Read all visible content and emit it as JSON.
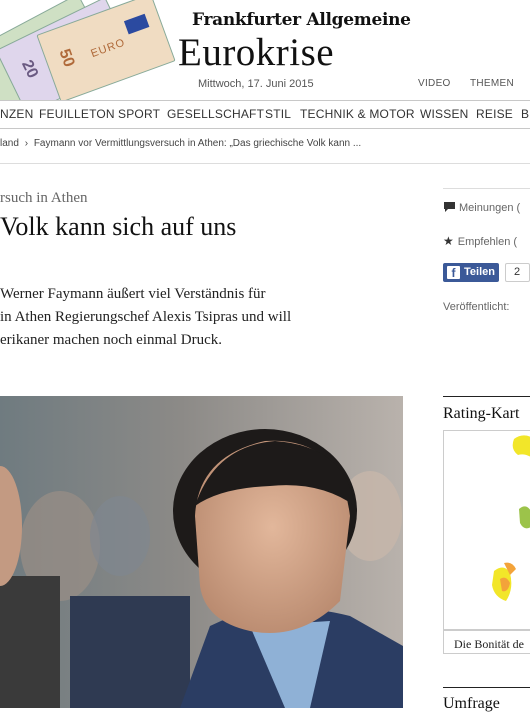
{
  "header": {
    "brand": "Frankfurter Allgemeine",
    "section_title": "Eurokrise",
    "date": "Mittwoch, 17. Juni 2015",
    "links": [
      "VIDEO",
      "THEMEN"
    ],
    "banknotes": [
      "20",
      "50"
    ],
    "banknote_text": "EURO"
  },
  "nav": {
    "items": [
      "NZEN",
      "FEUILLETON",
      "SPORT",
      "GESELLSCHAFT",
      "STIL",
      "TECHNIK & MOTOR",
      "WISSEN",
      "REISE",
      "B"
    ]
  },
  "breadcrumb": {
    "parent": "land",
    "current": "Faymann vor Vermittlungsversuch in Athen: „Das griechische Volk kann ..."
  },
  "article": {
    "kicker": "rsuch in Athen",
    "headline": "Volk kann sich auf uns",
    "teaser_lines": [
      "Werner Faymann äußert viel Verständnis für",
      "in Athen Regierungschef Alexis Tsipras und will",
      "erikaner machen noch einmal Druck."
    ]
  },
  "tools": {
    "opinions": "Meinungen (",
    "recommend": "Empfehlen (",
    "share_label": "Teilen",
    "share_count": "2",
    "published": "Veröffentlicht:"
  },
  "sidebar": {
    "rating_title": "Rating-Kart",
    "rating_caption": "Die Bonität de",
    "survey_title": "Umfrage"
  },
  "colors": {
    "facebook": "#3b5998",
    "map_yellow": "#f2e629",
    "map_green": "#9cc34a",
    "map_orange": "#f3a33a"
  }
}
